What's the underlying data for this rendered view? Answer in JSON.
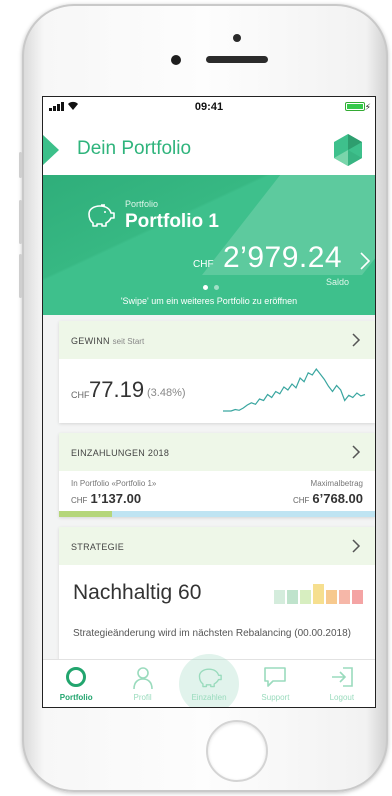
{
  "status_bar": {
    "time": "09:41"
  },
  "header": {
    "title": "Dein Portfolio"
  },
  "portfolio": {
    "label": "Portfolio",
    "name": "Portfolio 1",
    "currency": "CHF",
    "balance": "2’979.24",
    "balance_label": "Saldo",
    "swipe_hint": "'Swipe' um ein weiteres Portfolio zu eröffnen",
    "page_count": 2,
    "active_page": 1
  },
  "gain_card": {
    "title": "GEWINN",
    "title_suffix": "seit Start",
    "currency": "CHF",
    "value": "77.19",
    "percent": "(3.48%)",
    "sparkline": [
      2,
      2,
      2,
      2.2,
      2.1,
      2.4,
      2.8,
      3.1,
      2.9,
      3.6,
      3.4,
      4.2,
      3.8,
      4.6,
      4.3,
      5.2,
      4.8,
      5.6,
      5.1,
      6.4,
      5.9,
      7.1,
      6.8,
      7.6,
      6.9,
      6.2,
      5.3,
      4.6,
      5.4,
      4.8,
      3.4,
      4.1,
      3.8,
      4.4,
      4.0,
      4.2
    ]
  },
  "deposit_card": {
    "title": "EINZAHLUNGEN 2018",
    "left_label": "In Portfolio «Portfolio 1»",
    "left_currency": "CHF",
    "left_value": "1’137.00",
    "right_label": "Maximalbetrag",
    "right_currency": "CHF",
    "right_value": "6’768.00",
    "progress_fraction": 0.168
  },
  "strategy_card": {
    "title": "STRATEGIE",
    "name": "Nachhaltig 60",
    "note": "Strategieänderung wird im nächsten Rebalancing (00.00.2018)",
    "scale_colors": [
      "#d4ecdc",
      "#bfe3cc",
      "#d7eec0",
      "#f6df8f",
      "#f7c98e",
      "#f6b7a8",
      "#f4a4a4"
    ],
    "active_index": 3
  },
  "tabs": [
    {
      "id": "portfolio",
      "label": "Portfolio",
      "icon": "circle-icon",
      "active": true
    },
    {
      "id": "profil",
      "label": "Profil",
      "icon": "user-icon",
      "active": false
    },
    {
      "id": "einzahlen",
      "label": "Einzahlen",
      "icon": "piggy-bank-icon",
      "active": false
    },
    {
      "id": "support",
      "label": "Support",
      "icon": "chat-bubble-icon",
      "active": false
    },
    {
      "id": "logout",
      "label": "Logout",
      "icon": "logout-icon",
      "active": false
    }
  ],
  "colors": {
    "brand_green": "#3ec08c",
    "brand_dark": "#22a56e",
    "card_header": "#eef7e8"
  }
}
